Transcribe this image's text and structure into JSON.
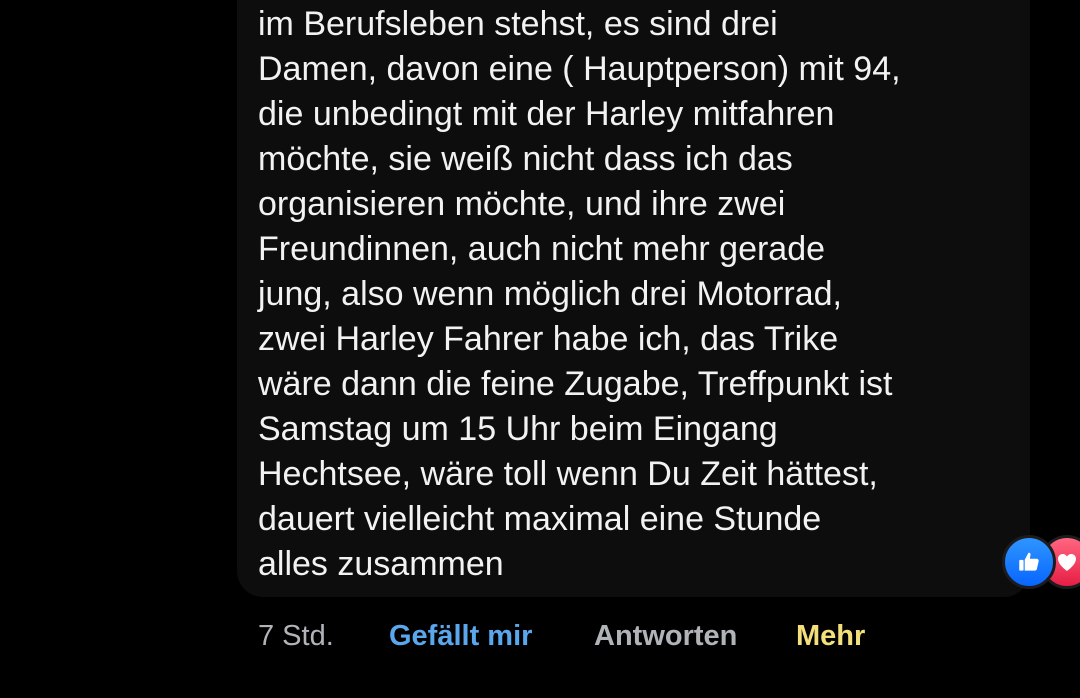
{
  "comment": {
    "lines": [
      "im Berufsleben stehst, es sind drei",
      "Damen, davon eine ( Hauptperson) mit 94,",
      "die unbedingt mit der Harley mitfahren",
      "möchte, sie weiß nicht dass ich das",
      "organisieren möchte, und ihre zwei",
      "Freundinnen, auch nicht mehr gerade",
      "jung, also wenn möglich drei Motorrad,",
      "zwei Harley Fahrer habe ich, das Trike",
      "wäre dann die feine Zugabe, Treffpunkt ist",
      "Samstag um 15 Uhr beim Eingang",
      "Hechtsee, wäre toll wenn Du Zeit hättest,",
      "dauert vielleicht maximal eine Stunde",
      "alles zusammen"
    ]
  },
  "reactions": {
    "icons": [
      "thumbs-up-icon",
      "heart-icon"
    ],
    "colors": {
      "like": "#0866ff",
      "love": "#f0284a"
    }
  },
  "actions": {
    "time": "7 Std.",
    "like_label": "Gefällt mir",
    "reply_label": "Antworten",
    "more_label": "Mehr"
  },
  "theme": {
    "background": "#000000",
    "bubble": "#0d0d0d",
    "text": "#f2f2f2",
    "muted": "#b0b3b8",
    "like_accent": "#5aa7ee",
    "more_accent": "#f3e07a"
  }
}
